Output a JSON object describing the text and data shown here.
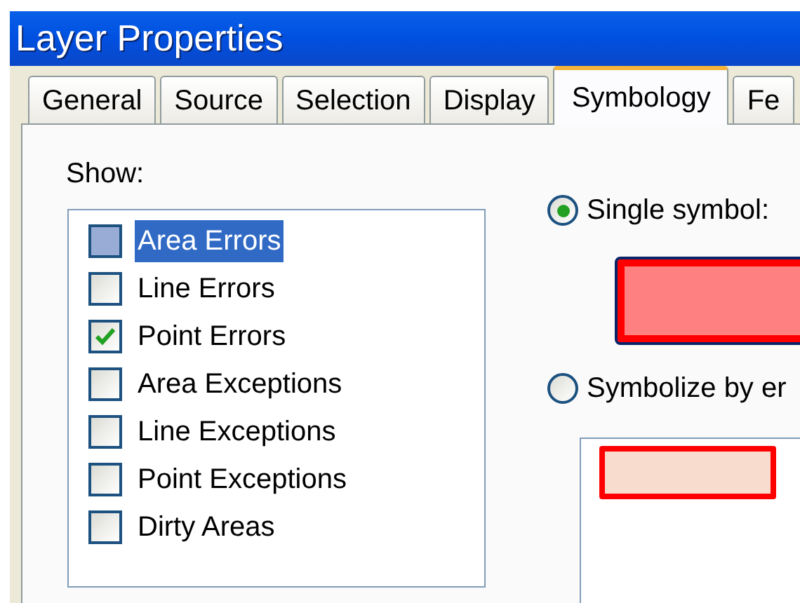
{
  "window": {
    "title": "Layer Properties"
  },
  "tabs": [
    {
      "label": "General",
      "selected": false
    },
    {
      "label": "Source",
      "selected": false
    },
    {
      "label": "Selection",
      "selected": false
    },
    {
      "label": "Display",
      "selected": false
    },
    {
      "label": "Symbology",
      "selected": true
    },
    {
      "label": "Fe",
      "selected": false
    }
  ],
  "show": {
    "label": "Show:",
    "items": [
      {
        "label": "Area Errors",
        "checked": false,
        "selected": true
      },
      {
        "label": "Line Errors",
        "checked": false,
        "selected": false
      },
      {
        "label": "Point Errors",
        "checked": true,
        "selected": false
      },
      {
        "label": "Area Exceptions",
        "checked": false,
        "selected": false
      },
      {
        "label": "Line Exceptions",
        "checked": false,
        "selected": false
      },
      {
        "label": "Point Exceptions",
        "checked": false,
        "selected": false
      },
      {
        "label": "Dirty Areas",
        "checked": false,
        "selected": false
      }
    ]
  },
  "symbol_options": [
    {
      "label": "Single symbol:",
      "selected": true
    },
    {
      "label": "Symbolize by er",
      "selected": false
    }
  ]
}
